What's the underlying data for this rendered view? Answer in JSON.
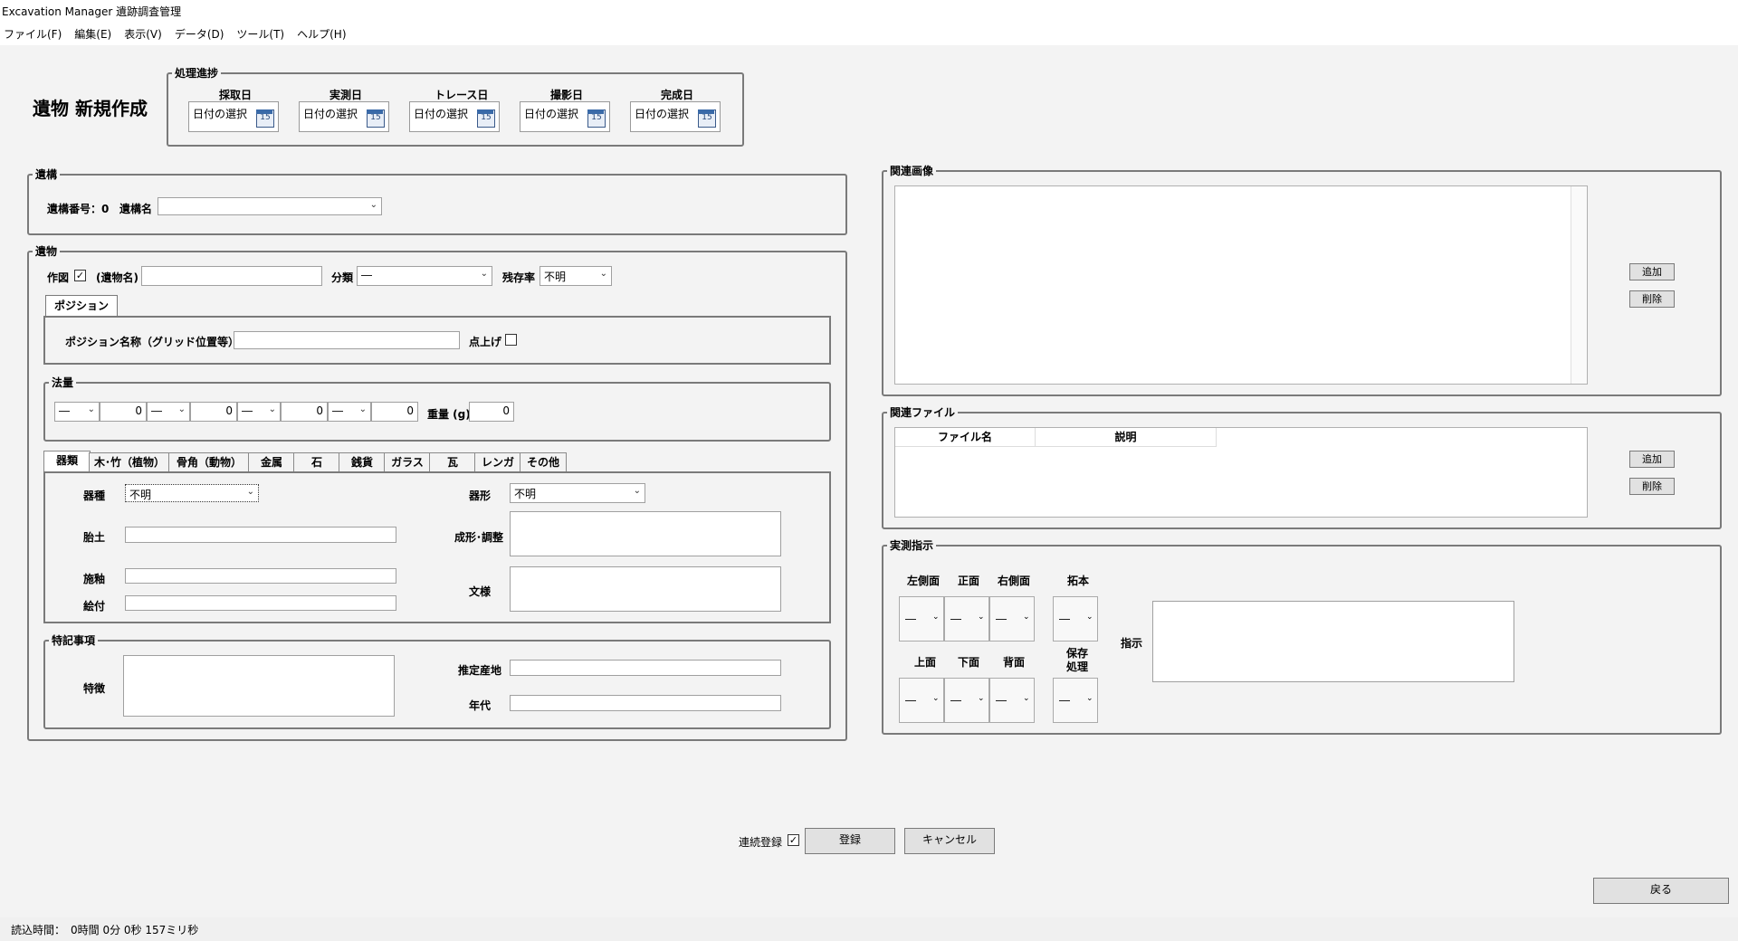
{
  "window": {
    "title": "Excavation Manager 遺跡調査管理"
  },
  "menu": [
    "ファイル(F)",
    "編集(E)",
    "表示(V)",
    "データ(D)",
    "ツール(T)",
    "ヘルプ(H)"
  ],
  "page": {
    "title": "遺物 新規作成"
  },
  "progress": {
    "legend": "処理進捗",
    "dates": [
      {
        "label": "採取日",
        "value": "日付の選択"
      },
      {
        "label": "実測日",
        "value": "日付の選択"
      },
      {
        "label": "トレース日",
        "value": "日付の選択"
      },
      {
        "label": "撮影日",
        "value": "日付の選択"
      },
      {
        "label": "完成日",
        "value": "日付の選択"
      }
    ],
    "cal_day": "15"
  },
  "iko": {
    "legend": "遺構",
    "number_label": "遺構番号：0",
    "name_label": "遺構名",
    "name_value": ""
  },
  "ibutsu": {
    "legend": "遺物",
    "sakuzu_label": "作図",
    "name_label": "(遺物名)",
    "bunrui_label": "分類",
    "bunrui_value": "―",
    "zanson_label": "残存率",
    "zanson_value": "不明",
    "position_tab": "ポジション",
    "position_name_label": "ポジション名称（グリッド位置等）",
    "tenage_label": "点上げ",
    "horyo_legend": "法量",
    "dims": [
      {
        "sel": "―",
        "val": "0"
      },
      {
        "sel": "―",
        "val": "0"
      },
      {
        "sel": "―",
        "val": "0"
      },
      {
        "sel": "―",
        "val": "0"
      }
    ],
    "weight_label": "重量 (g)",
    "weight_value": "0",
    "tabs": [
      "器類",
      "木･竹（植物）",
      "骨角（動物）",
      "金属",
      "石",
      "銭貨",
      "ガラス",
      "瓦",
      "レンガ",
      "その他"
    ],
    "kishu_label": "器種",
    "kishu_value": "不明",
    "kikei_label": "器形",
    "kikei_value": "不明",
    "taido_label": "胎土",
    "seikei_label": "成形･調整",
    "seyu_label": "施釉",
    "etsuke_label": "絵付",
    "monyo_label": "文様",
    "tokki_legend": "特記事項",
    "tokucho_label": "特徴",
    "sanchi_label": "推定産地",
    "nendai_label": "年代"
  },
  "images": {
    "legend": "関連画像",
    "add": "追加",
    "delete": "削除"
  },
  "files": {
    "legend": "関連ファイル",
    "columns": [
      "ファイル名",
      "説明"
    ],
    "add": "追加",
    "delete": "削除"
  },
  "jissoku": {
    "legend": "実測指示",
    "views_top": [
      "左側面",
      "正面",
      "右側面"
    ],
    "views_bottom": [
      "上面",
      "下面",
      "背面"
    ],
    "takuhon": "拓本",
    "hozon": "保存\n処理",
    "dd_value": "―",
    "shiji_label": "指示"
  },
  "footer": {
    "renzoku_label": "連続登録",
    "register": "登録",
    "cancel": "キャンセル",
    "back": "戻る"
  },
  "status": {
    "text": "読込時間：　0時間 0分 0秒 157ミリ秒"
  }
}
